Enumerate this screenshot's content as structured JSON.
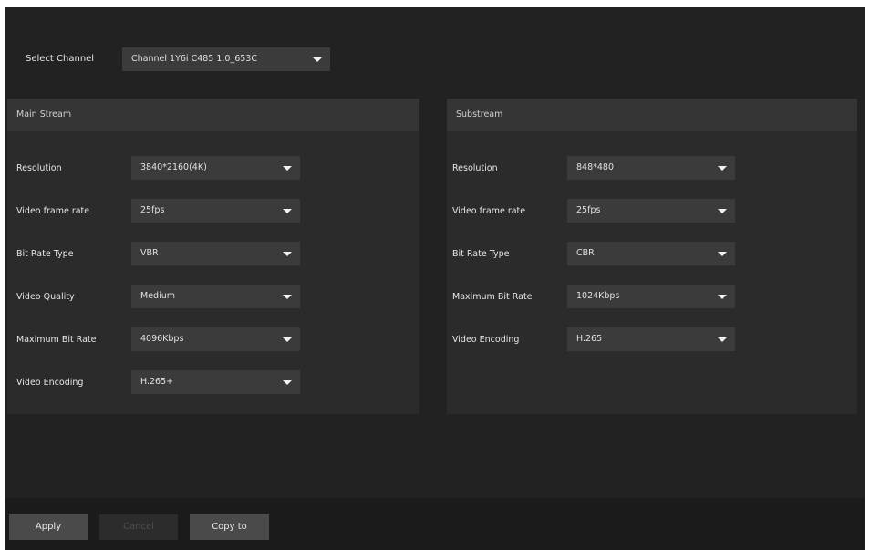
{
  "channel": {
    "label": "Select Channel",
    "value": "Channel 1Y6i C485 1.0_653C"
  },
  "main_stream": {
    "title": "Main Stream",
    "fields": [
      {
        "label": "Resolution",
        "value": "3840*2160(4K)"
      },
      {
        "label": "Video frame rate",
        "value": "25fps"
      },
      {
        "label": "Bit Rate Type",
        "value": "VBR"
      },
      {
        "label": "Video Quality",
        "value": "Medium"
      },
      {
        "label": "Maximum Bit Rate",
        "value": "4096Kbps"
      },
      {
        "label": "Video Encoding",
        "value": "H.265+"
      }
    ]
  },
  "substream": {
    "title": "Substream",
    "fields": [
      {
        "label": "Resolution",
        "value": "848*480"
      },
      {
        "label": "Video frame rate",
        "value": "25fps"
      },
      {
        "label": "Bit Rate Type",
        "value": "CBR"
      },
      {
        "label": "Maximum Bit Rate",
        "value": "1024Kbps"
      },
      {
        "label": "Video Encoding",
        "value": "H.265"
      }
    ]
  },
  "footer": {
    "apply_label": "Apply",
    "cancel_label": "Cancel",
    "copy_label": "Copy to"
  },
  "colors": {
    "background": "#222222",
    "panel": "#2b2b2b",
    "panel_header": "#353535",
    "dropdown": "#3b3b3b",
    "footer": "#1b1b1b",
    "button": "#4a4a4a"
  }
}
